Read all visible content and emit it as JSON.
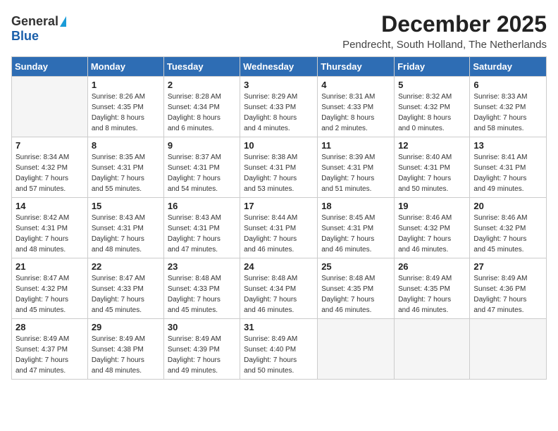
{
  "logo": {
    "general": "General",
    "blue": "Blue"
  },
  "title": {
    "month": "December 2025",
    "location": "Pendrecht, South Holland, The Netherlands"
  },
  "days_header": [
    "Sunday",
    "Monday",
    "Tuesday",
    "Wednesday",
    "Thursday",
    "Friday",
    "Saturday"
  ],
  "weeks": [
    [
      {
        "day": "",
        "info": ""
      },
      {
        "day": "1",
        "info": "Sunrise: 8:26 AM\nSunset: 4:35 PM\nDaylight: 8 hours\nand 8 minutes."
      },
      {
        "day": "2",
        "info": "Sunrise: 8:28 AM\nSunset: 4:34 PM\nDaylight: 8 hours\nand 6 minutes."
      },
      {
        "day": "3",
        "info": "Sunrise: 8:29 AM\nSunset: 4:33 PM\nDaylight: 8 hours\nand 4 minutes."
      },
      {
        "day": "4",
        "info": "Sunrise: 8:31 AM\nSunset: 4:33 PM\nDaylight: 8 hours\nand 2 minutes."
      },
      {
        "day": "5",
        "info": "Sunrise: 8:32 AM\nSunset: 4:32 PM\nDaylight: 8 hours\nand 0 minutes."
      },
      {
        "day": "6",
        "info": "Sunrise: 8:33 AM\nSunset: 4:32 PM\nDaylight: 7 hours\nand 58 minutes."
      }
    ],
    [
      {
        "day": "7",
        "info": "Sunrise: 8:34 AM\nSunset: 4:32 PM\nDaylight: 7 hours\nand 57 minutes."
      },
      {
        "day": "8",
        "info": "Sunrise: 8:35 AM\nSunset: 4:31 PM\nDaylight: 7 hours\nand 55 minutes."
      },
      {
        "day": "9",
        "info": "Sunrise: 8:37 AM\nSunset: 4:31 PM\nDaylight: 7 hours\nand 54 minutes."
      },
      {
        "day": "10",
        "info": "Sunrise: 8:38 AM\nSunset: 4:31 PM\nDaylight: 7 hours\nand 53 minutes."
      },
      {
        "day": "11",
        "info": "Sunrise: 8:39 AM\nSunset: 4:31 PM\nDaylight: 7 hours\nand 51 minutes."
      },
      {
        "day": "12",
        "info": "Sunrise: 8:40 AM\nSunset: 4:31 PM\nDaylight: 7 hours\nand 50 minutes."
      },
      {
        "day": "13",
        "info": "Sunrise: 8:41 AM\nSunset: 4:31 PM\nDaylight: 7 hours\nand 49 minutes."
      }
    ],
    [
      {
        "day": "14",
        "info": "Sunrise: 8:42 AM\nSunset: 4:31 PM\nDaylight: 7 hours\nand 48 minutes."
      },
      {
        "day": "15",
        "info": "Sunrise: 8:43 AM\nSunset: 4:31 PM\nDaylight: 7 hours\nand 48 minutes."
      },
      {
        "day": "16",
        "info": "Sunrise: 8:43 AM\nSunset: 4:31 PM\nDaylight: 7 hours\nand 47 minutes."
      },
      {
        "day": "17",
        "info": "Sunrise: 8:44 AM\nSunset: 4:31 PM\nDaylight: 7 hours\nand 46 minutes."
      },
      {
        "day": "18",
        "info": "Sunrise: 8:45 AM\nSunset: 4:31 PM\nDaylight: 7 hours\nand 46 minutes."
      },
      {
        "day": "19",
        "info": "Sunrise: 8:46 AM\nSunset: 4:32 PM\nDaylight: 7 hours\nand 46 minutes."
      },
      {
        "day": "20",
        "info": "Sunrise: 8:46 AM\nSunset: 4:32 PM\nDaylight: 7 hours\nand 45 minutes."
      }
    ],
    [
      {
        "day": "21",
        "info": "Sunrise: 8:47 AM\nSunset: 4:32 PM\nDaylight: 7 hours\nand 45 minutes."
      },
      {
        "day": "22",
        "info": "Sunrise: 8:47 AM\nSunset: 4:33 PM\nDaylight: 7 hours\nand 45 minutes."
      },
      {
        "day": "23",
        "info": "Sunrise: 8:48 AM\nSunset: 4:33 PM\nDaylight: 7 hours\nand 45 minutes."
      },
      {
        "day": "24",
        "info": "Sunrise: 8:48 AM\nSunset: 4:34 PM\nDaylight: 7 hours\nand 46 minutes."
      },
      {
        "day": "25",
        "info": "Sunrise: 8:48 AM\nSunset: 4:35 PM\nDaylight: 7 hours\nand 46 minutes."
      },
      {
        "day": "26",
        "info": "Sunrise: 8:49 AM\nSunset: 4:35 PM\nDaylight: 7 hours\nand 46 minutes."
      },
      {
        "day": "27",
        "info": "Sunrise: 8:49 AM\nSunset: 4:36 PM\nDaylight: 7 hours\nand 47 minutes."
      }
    ],
    [
      {
        "day": "28",
        "info": "Sunrise: 8:49 AM\nSunset: 4:37 PM\nDaylight: 7 hours\nand 47 minutes."
      },
      {
        "day": "29",
        "info": "Sunrise: 8:49 AM\nSunset: 4:38 PM\nDaylight: 7 hours\nand 48 minutes."
      },
      {
        "day": "30",
        "info": "Sunrise: 8:49 AM\nSunset: 4:39 PM\nDaylight: 7 hours\nand 49 minutes."
      },
      {
        "day": "31",
        "info": "Sunrise: 8:49 AM\nSunset: 4:40 PM\nDaylight: 7 hours\nand 50 minutes."
      },
      {
        "day": "",
        "info": ""
      },
      {
        "day": "",
        "info": ""
      },
      {
        "day": "",
        "info": ""
      }
    ]
  ]
}
